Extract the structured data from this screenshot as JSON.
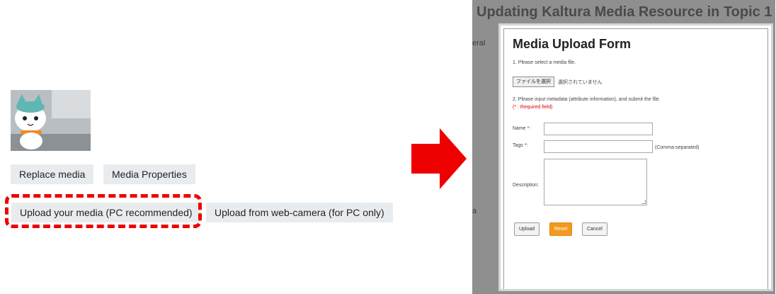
{
  "left_panel": {
    "thumbnail": {
      "icon": "cat-mascot-photo"
    },
    "buttons": {
      "replace_media": "Replace media",
      "media_properties": "Media Properties",
      "upload_media": "Upload your media (PC recommended)",
      "upload_webcam": "Upload from web-camera (for PC only)"
    },
    "highlight_color": "#ee0000"
  },
  "arrow": {
    "color": "#ee0000",
    "icon": "right-arrow-icon"
  },
  "right_screenshot": {
    "background_title": "Updating Kaltura Media Resource in Topic 1",
    "background_side_text_top": "eral",
    "background_side_text_bottom": "a",
    "form": {
      "title": "Media Upload Form",
      "step1": "1. Please select a media file.",
      "file_button": "ファイルを選択",
      "file_status": "選択されていません",
      "step2": "2. Please input metadata (attribute information), and submit the file.",
      "required_note": "(* : Required field)",
      "name_label": "Name",
      "tags_label": "Tags",
      "required_mark": "*",
      "tags_hint": "(Comma-separated)",
      "description_label": "Description:",
      "buttons": {
        "upload": "Upload",
        "reset": "Reset",
        "cancel": "Cancel"
      },
      "accent_color": "#f39a1e"
    }
  }
}
